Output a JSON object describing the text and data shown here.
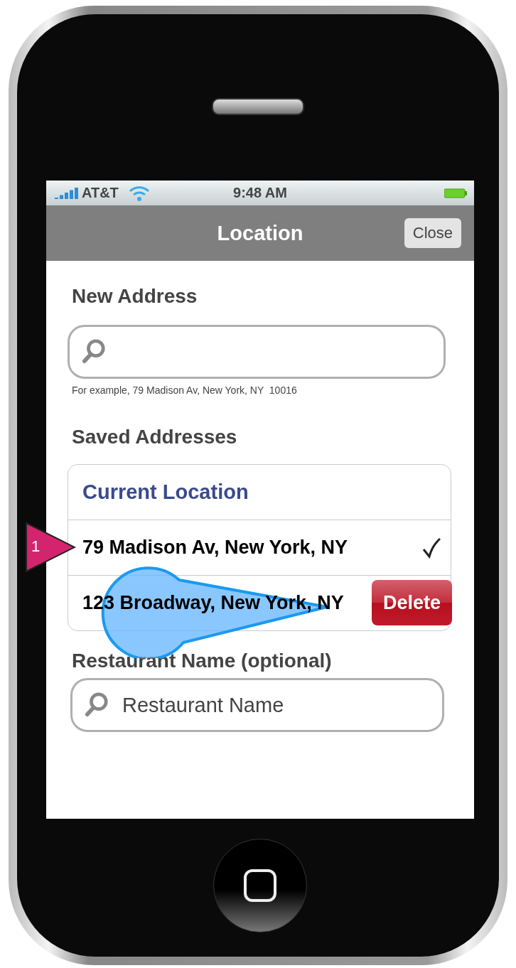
{
  "status_bar": {
    "carrier": "AT&T",
    "time": "9:48 AM"
  },
  "nav_bar": {
    "title": "Location",
    "close_button": "Close"
  },
  "new_address": {
    "heading": "New Address",
    "hint": "For example, 79 Madison Av, New York, NY  10016"
  },
  "saved_addresses": {
    "heading": "Saved Addresses",
    "header": "Current Location",
    "rows": [
      {
        "label": "79 Madison Av, New York, NY",
        "checked": true
      },
      {
        "label": "123 Broadway, New York, NY",
        "checked": false,
        "delete_button": "Delete"
      }
    ]
  },
  "restaurant": {
    "heading": "Restaurant Name (optional)",
    "placeholder": "Restaurant Name"
  },
  "annotation": {
    "number": "1"
  }
}
